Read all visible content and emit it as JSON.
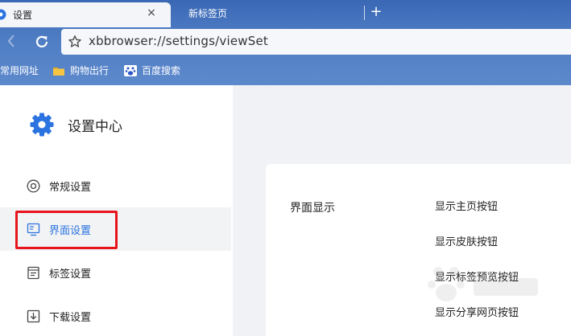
{
  "browser": {
    "active_tab_title": "设置",
    "inactive_tab_title": "新标签页",
    "new_tab_label": "+",
    "close_tab_label": "×",
    "address": "xbbrowser://settings/viewSet",
    "bookmarks": [
      {
        "label": "常用网址",
        "icon": "none"
      },
      {
        "label": "购物出行",
        "icon": "folder-icon"
      },
      {
        "label": "百度搜索",
        "icon": "paw-icon"
      }
    ],
    "accent_color": "#3a68b5"
  },
  "settings": {
    "brand_title": "设置中心",
    "nav": [
      {
        "label": "常规设置",
        "icon": "circle-gear-icon",
        "selected": false
      },
      {
        "label": "界面设置",
        "icon": "monitor-icon",
        "selected": true
      },
      {
        "label": "标签设置",
        "icon": "document-icon",
        "selected": false
      },
      {
        "label": "下载设置",
        "icon": "download-icon",
        "selected": false
      }
    ],
    "selected_color": "#2b73e0",
    "highlight_color": "#e8141b",
    "section_title": "界面显示",
    "options": [
      "显示主页按钮",
      "显示皮肤按钮",
      "显示标签预览按钮",
      "显示分享网页按钮"
    ]
  }
}
